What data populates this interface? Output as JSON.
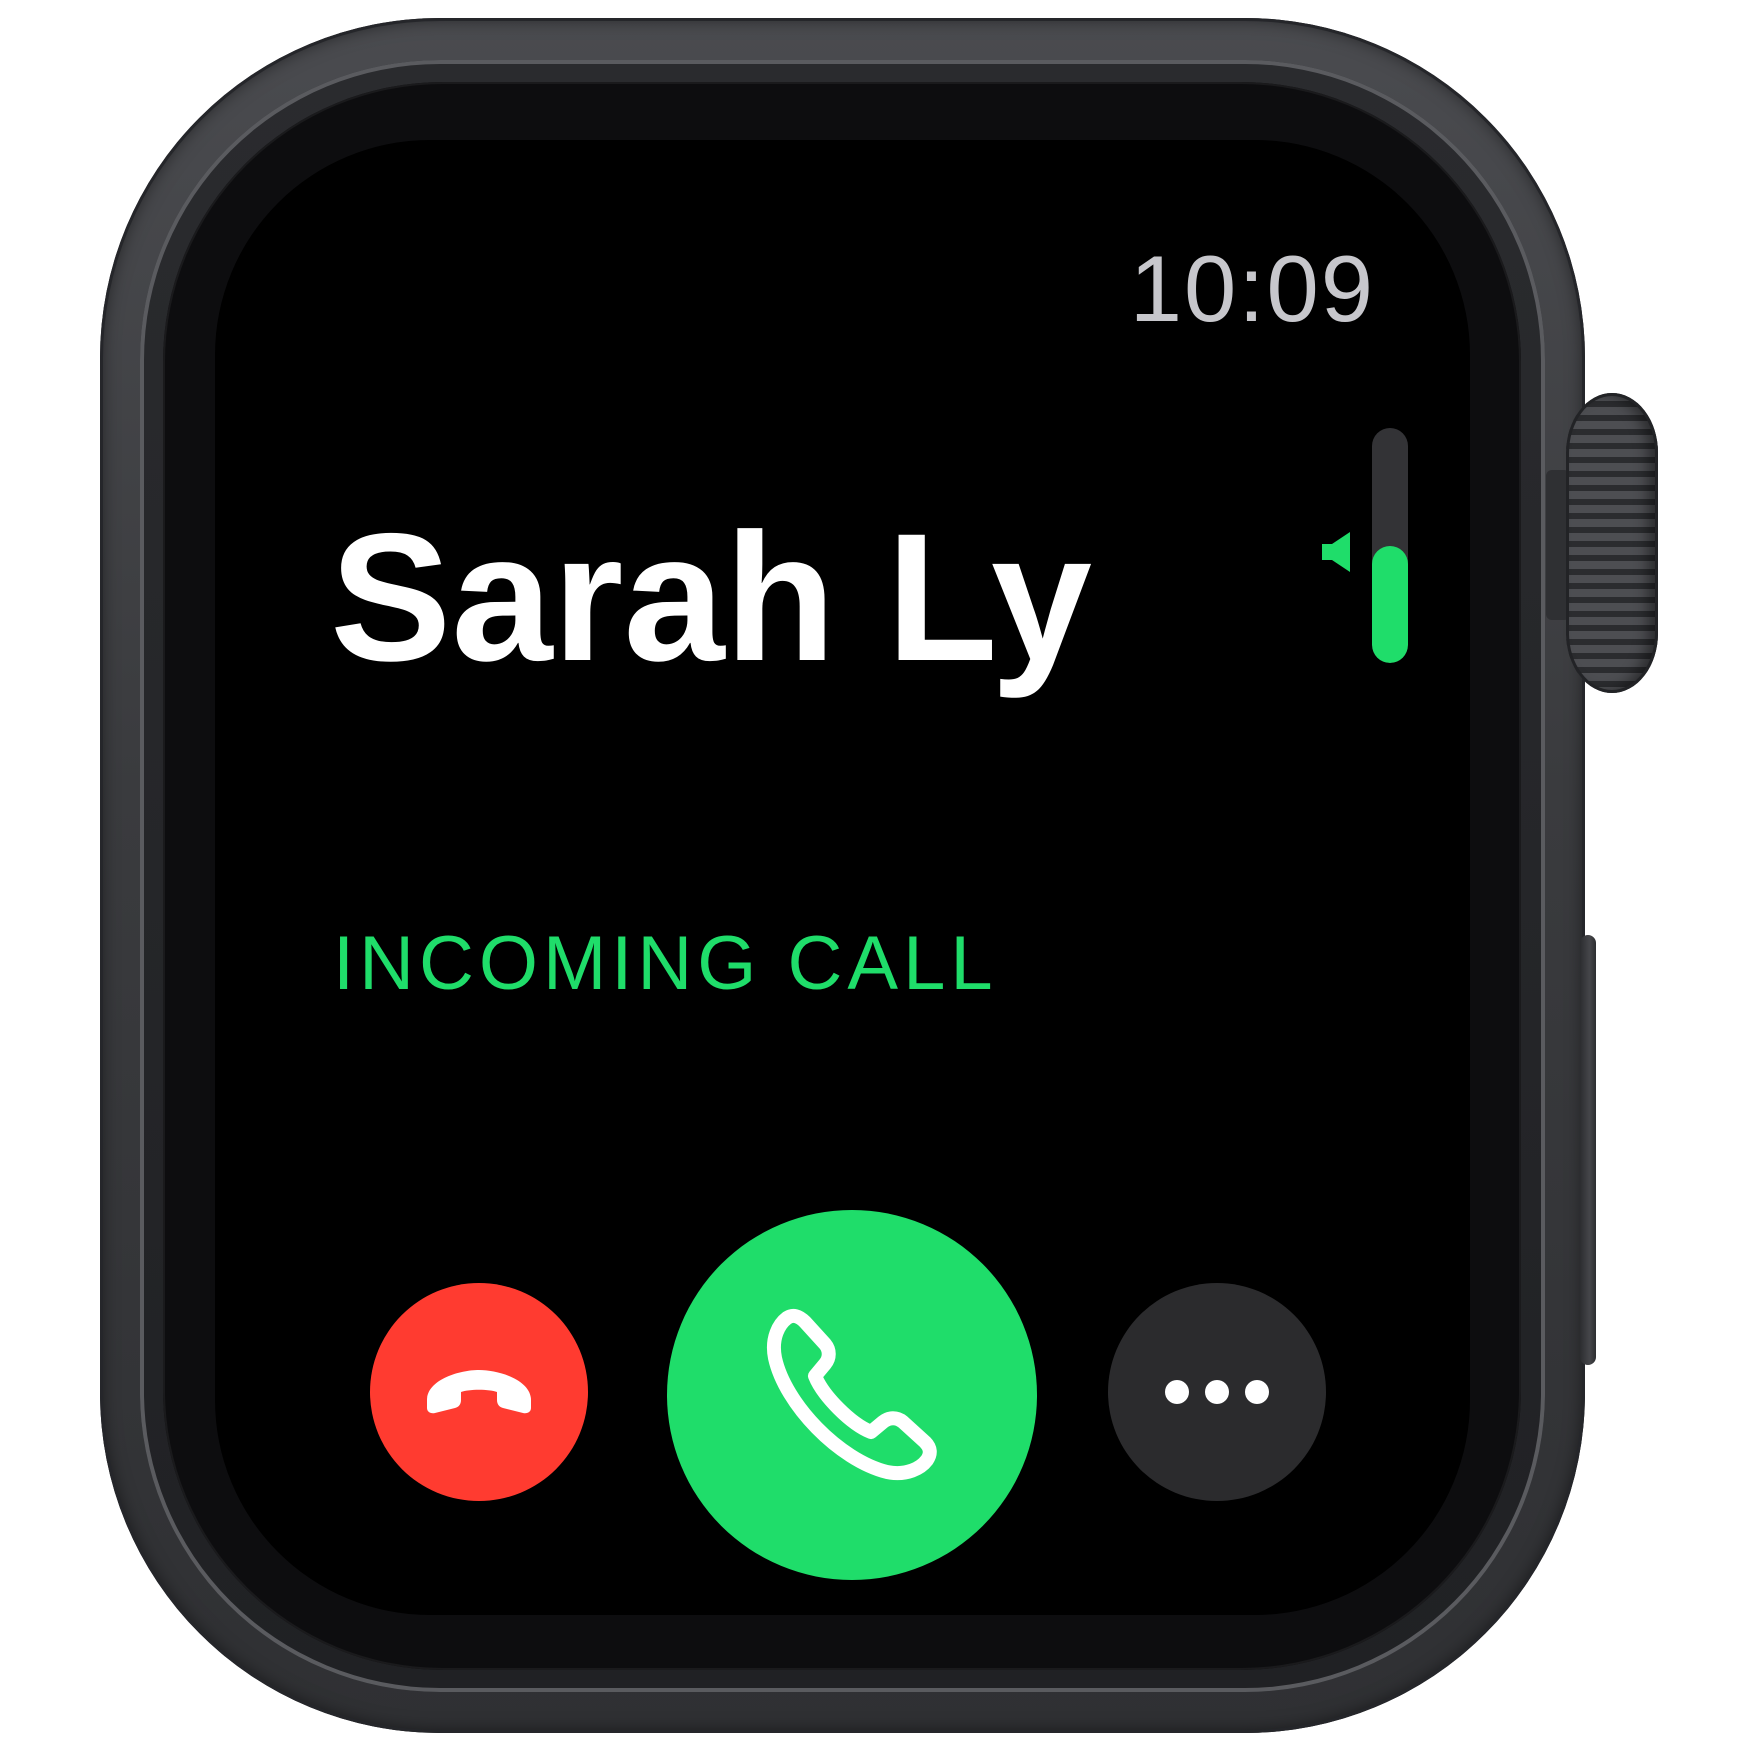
{
  "status_bar": {
    "time": "10:09"
  },
  "call": {
    "caller_name": "Sarah Ly",
    "status": "INCOMING CALL"
  },
  "volume": {
    "level": 0.5
  },
  "actions": {
    "decline_icon": "phone-down-icon",
    "accept_icon": "phone-icon",
    "more_icon": "ellipsis-icon"
  },
  "colors": {
    "accept": "#1fdd6a",
    "decline": "#ff3b30",
    "more": "#2b2b2d",
    "status_text": "#1fdd6a",
    "clock_text": "#c7c7cc"
  }
}
